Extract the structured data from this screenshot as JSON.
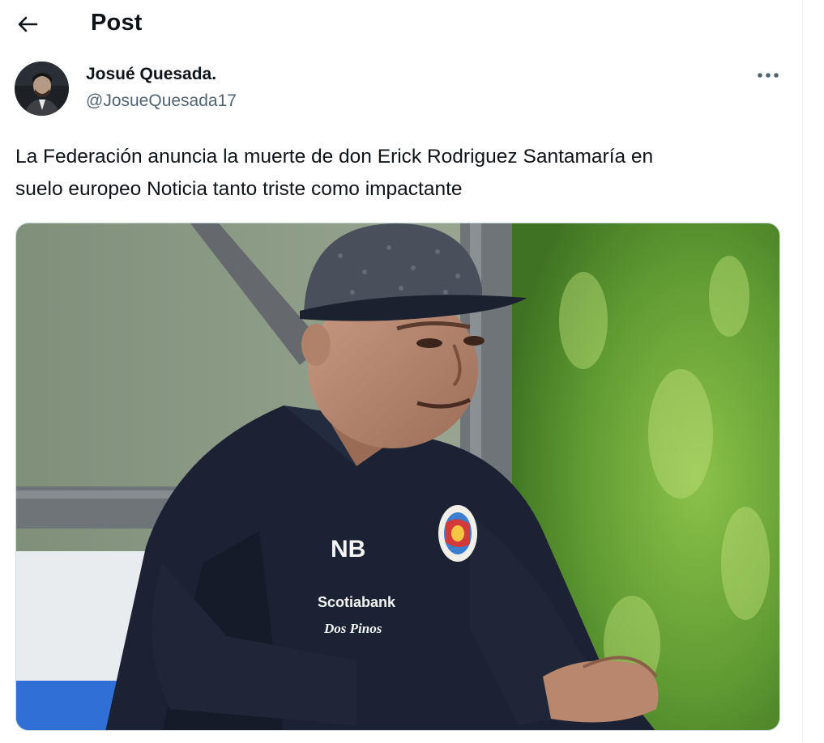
{
  "header": {
    "title": "Post",
    "back_icon": "arrow-left-icon"
  },
  "author": {
    "name": "Josué Quesada.",
    "handle": "@JosueQuesada17",
    "avatar_icon": "avatar"
  },
  "more_icon": "more-horizontal-icon",
  "post": {
    "text_line1": "La Federación anuncia la muerte de don Erick Rodriguez Santamaría en",
    "text_line2": "suelo europeo Noticia tanto triste como impactante"
  },
  "media": {
    "shirt_sponsor_1": "Scotiabank",
    "shirt_sponsor_2": "Dos Pinos",
    "shirt_brand": "NB"
  },
  "colors": {
    "text_primary": "#0f1419",
    "text_secondary": "#536471",
    "border": "#cfd9de"
  }
}
